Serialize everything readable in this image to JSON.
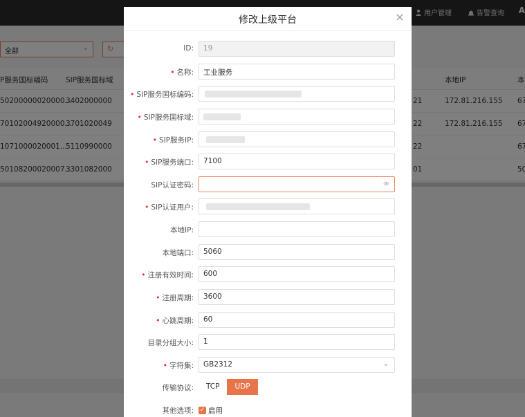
{
  "background": {
    "top_nav": [
      {
        "label": "用户管理",
        "icon": "user-icon"
      },
      {
        "label": "告警查询",
        "icon": "alarm-icon"
      }
    ],
    "top_extra": "A",
    "filter": {
      "selected": "全部"
    },
    "table": {
      "headers": [
        "P服务国标编码",
        "SIP服务国标域",
        "",
        "本地IP",
        "本"
      ],
      "rows": [
        {
          "code": "50200000020000...",
          "domain": "3402000000",
          "mid": "21",
          "ip": "172.81.216.155",
          "tail": "67"
        },
        {
          "code": "70102004920000...",
          "domain": "3701020049",
          "mid": "22",
          "ip": "172.81.216.155",
          "tail": "67"
        },
        {
          "code": "1071000020001...",
          "domain": "5110990000",
          "mid": "22",
          "ip": "",
          "tail": "67"
        },
        {
          "code": "50108200020007...",
          "domain": "3301082000",
          "mid": "01",
          "ip": "",
          "tail": "50"
        }
      ]
    }
  },
  "modal": {
    "title": "修改上级平台",
    "fields": {
      "id": {
        "label": "ID:",
        "value": "19"
      },
      "name": {
        "label": "名称:",
        "value": "工业服务"
      },
      "sip_code": {
        "label": "SIP服务国标编码:",
        "value": ""
      },
      "sip_domain": {
        "label": "SIP服务国标域:",
        "value": ""
      },
      "sip_ip": {
        "label": "SIP服务IP:",
        "value": ""
      },
      "sip_port": {
        "label": "SIP服务端口:",
        "value": "7100"
      },
      "sip_password": {
        "label": "SIP认证密码:",
        "value": ""
      },
      "sip_user": {
        "label": "SIP认证用户:",
        "value": ""
      },
      "local_ip": {
        "label": "本地IP:",
        "value": ""
      },
      "local_port": {
        "label": "本地端口:",
        "value": "5060"
      },
      "register_expire": {
        "label": "注册有效时间:",
        "value": "600"
      },
      "register_period": {
        "label": "注册周期:",
        "value": "3600"
      },
      "heartbeat_period": {
        "label": "心跳周期:",
        "value": "60"
      },
      "catalog_group_size": {
        "label": "目录分组大小:",
        "value": "1"
      },
      "charset": {
        "label": "字符集:",
        "value": "GB2312"
      },
      "transport": {
        "label": "传输协议:",
        "options": [
          "TCP",
          "UDP"
        ],
        "selected": "UDP"
      },
      "other": {
        "label": "其他选项:",
        "checkbox_label": "启用",
        "checked": true
      }
    }
  },
  "colors": {
    "accent": "#e8744a",
    "required": "#f5222d"
  }
}
